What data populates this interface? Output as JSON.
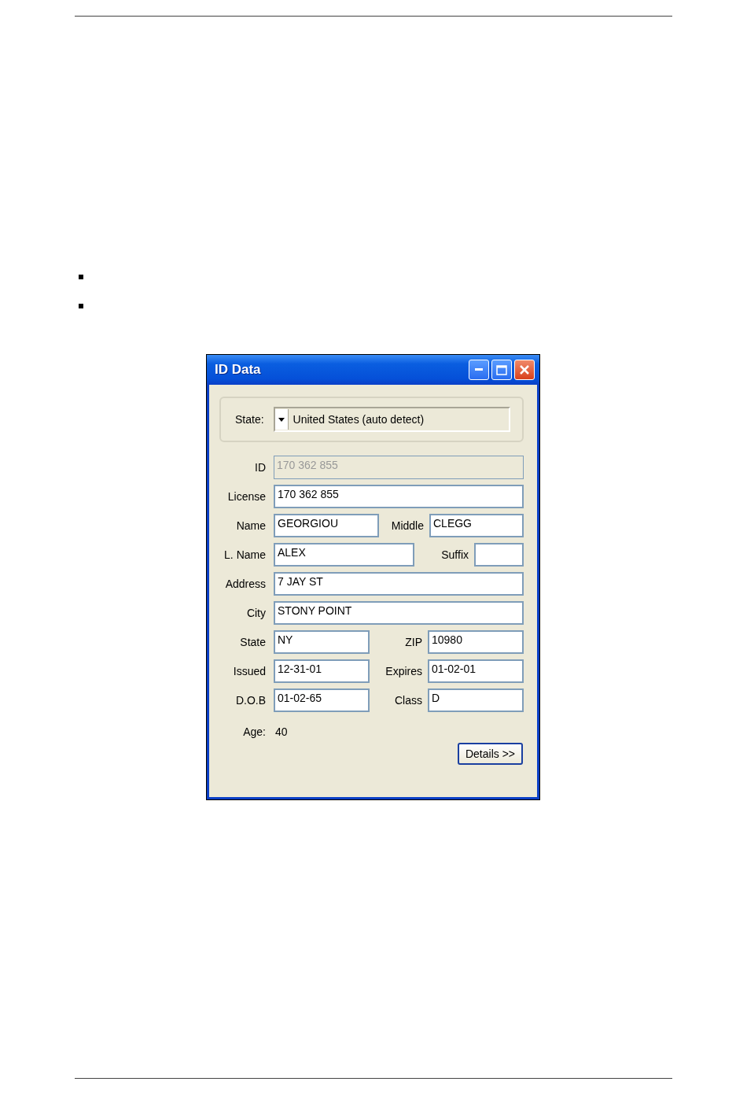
{
  "window": {
    "title": "ID Data"
  },
  "state_selector": {
    "label": "State:",
    "value": "United States (auto detect)"
  },
  "rows": [
    {
      "kind": "single",
      "fields": [
        {
          "label": "ID",
          "value": "170 362 855",
          "disabled": true
        }
      ]
    },
    {
      "kind": "single",
      "fields": [
        {
          "label": "License",
          "value": "170 362 855",
          "disabled": false
        }
      ]
    },
    {
      "kind": "name",
      "fields": [
        {
          "label": "Name",
          "value": "GEORGIOU",
          "disabled": false
        },
        {
          "label": "Middle",
          "value": "CLEGG",
          "disabled": false
        }
      ]
    },
    {
      "kind": "suffix",
      "fields": [
        {
          "label": "L. Name",
          "value": "ALEX",
          "disabled": false
        },
        {
          "label": "Suffix",
          "disabled": false
        }
      ]
    },
    {
      "kind": "single",
      "fields": [
        {
          "label": "Address",
          "value": "7 JAY ST",
          "disabled": false
        }
      ]
    },
    {
      "kind": "single",
      "fields": [
        {
          "label": "City",
          "value": "STONY POINT",
          "disabled": false
        }
      ]
    },
    {
      "kind": "pair",
      "fields": [
        {
          "label": "State",
          "value": "NY",
          "disabled": false
        },
        {
          "label": "ZIP",
          "value": "10980",
          "disabled": false
        }
      ]
    },
    {
      "kind": "pair",
      "fields": [
        {
          "label": "Issued",
          "value": "12-31-01",
          "disabled": false
        },
        {
          "label": "Expires",
          "value": "01-02-01",
          "disabled": false
        }
      ]
    },
    {
      "kind": "pair",
      "fields": [
        {
          "label": "D.O.B",
          "value": "01-02-65",
          "disabled": false
        },
        {
          "label": "Class",
          "value": "D",
          "disabled": false
        }
      ]
    }
  ],
  "age": {
    "label": "Age:",
    "value": "40"
  },
  "buttons": [
    "Details >>"
  ]
}
